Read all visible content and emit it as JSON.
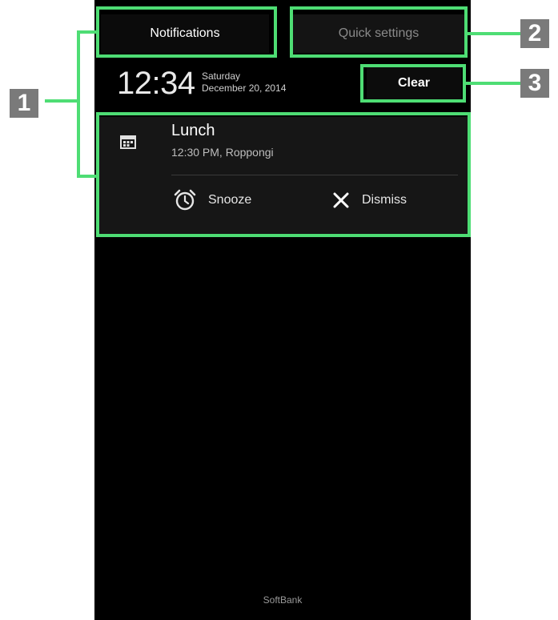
{
  "tabs": {
    "notifications_label": "Notifications",
    "quick_settings_label": "Quick settings"
  },
  "header": {
    "time": "12:34",
    "day": "Saturday",
    "date": "December 20, 2014",
    "clear_label": "Clear"
  },
  "notification": {
    "icon": "calendar-icon",
    "title": "Lunch",
    "subtitle": "12:30 PM, Roppongi",
    "actions": [
      {
        "label": "Snooze",
        "icon": "alarm-clock-icon"
      },
      {
        "label": "Dismiss",
        "icon": "close-icon"
      }
    ]
  },
  "footer": {
    "carrier": "SoftBank"
  },
  "callouts": {
    "one": "1",
    "two": "2",
    "three": "3",
    "color": "#4edd74"
  }
}
